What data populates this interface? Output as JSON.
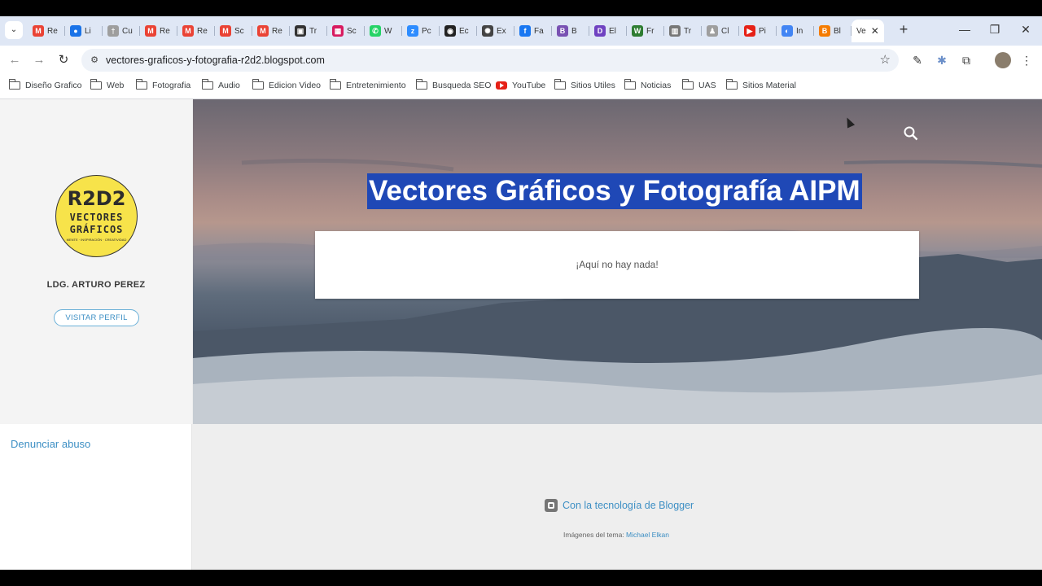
{
  "browser": {
    "tabs": [
      {
        "label": "Re",
        "icon": "gmail-icon",
        "color": "#ea4335",
        "glyph": "M"
      },
      {
        "label": "Li",
        "icon": "link-icon",
        "color": "#1a73e8",
        "glyph": "●"
      },
      {
        "label": "Cu",
        "icon": "site-icon",
        "color": "#9e9e9e",
        "glyph": "†"
      },
      {
        "label": "Re",
        "icon": "gmail-icon",
        "color": "#ea4335",
        "glyph": "M"
      },
      {
        "label": "Re",
        "icon": "gmail-icon",
        "color": "#ea4335",
        "glyph": "M"
      },
      {
        "label": "Sc",
        "icon": "gmail-icon",
        "color": "#ea4335",
        "glyph": "M"
      },
      {
        "label": "Re",
        "icon": "gmail-icon",
        "color": "#ea4335",
        "glyph": "M"
      },
      {
        "label": "Tr",
        "icon": "contact-icon",
        "color": "#333333",
        "glyph": "▣"
      },
      {
        "label": "Sc",
        "icon": "grid-icon",
        "color": "#d81b60",
        "glyph": "▦"
      },
      {
        "label": "W",
        "icon": "whatsapp-icon",
        "color": "#25d366",
        "glyph": "✆"
      },
      {
        "label": "Pc",
        "icon": "zoom-icon",
        "color": "#2d8cff",
        "glyph": "z"
      },
      {
        "label": "Ec",
        "icon": "circle-icon",
        "color": "#222222",
        "glyph": "◉"
      },
      {
        "label": "Ex",
        "icon": "openai-icon",
        "color": "#444444",
        "glyph": "✺"
      },
      {
        "label": "Fa",
        "icon": "facebook-icon",
        "color": "#1877f2",
        "glyph": "f"
      },
      {
        "label": "B",
        "icon": "bootstrap-icon",
        "color": "#7952b3",
        "glyph": "B"
      },
      {
        "label": "El",
        "icon": "purple-icon",
        "color": "#6f42c1",
        "glyph": "D"
      },
      {
        "label": "Fr",
        "icon": "w-icon",
        "color": "#2e7d32",
        "glyph": "W"
      },
      {
        "label": "Tr",
        "icon": "chart-icon",
        "color": "#777777",
        "glyph": "▥"
      },
      {
        "label": "Cl",
        "icon": "site-icon",
        "color": "#9e9e9e",
        "glyph": "♟"
      },
      {
        "label": "Pi",
        "icon": "youtube-icon",
        "color": "#e62117",
        "glyph": "▶"
      },
      {
        "label": "In",
        "icon": "chrome-icon",
        "color": "#4285f4",
        "glyph": "◐"
      },
      {
        "label": "Bl",
        "icon": "blogger-icon",
        "color": "#f57c00",
        "glyph": "B"
      }
    ],
    "active_tab": {
      "label": "Ve"
    },
    "url": "vectores-graficos-y-fotografia-r2d2.blogspot.com",
    "bookmarks": [
      {
        "label": "Diseño Grafico",
        "type": "folder"
      },
      {
        "label": "Web",
        "type": "folder"
      },
      {
        "label": "Fotografia",
        "type": "folder"
      },
      {
        "label": "Audio",
        "type": "folder"
      },
      {
        "label": "Edicion Video",
        "type": "folder"
      },
      {
        "label": "Entretenimiento",
        "type": "folder"
      },
      {
        "label": "Busqueda SEO",
        "type": "folder"
      },
      {
        "label": "YouTube",
        "type": "youtube"
      },
      {
        "label": "Sitios Utiles",
        "type": "folder"
      },
      {
        "label": "Noticias",
        "type": "folder"
      },
      {
        "label": "UAS",
        "type": "folder"
      },
      {
        "label": "Sitios Material",
        "type": "folder"
      }
    ]
  },
  "sidebar": {
    "logo": {
      "line1": "R2D2",
      "line2a": "VECTORES",
      "line2b": "GRÁFICOS",
      "tagline": "MENTE · INSPIRACIÓN · CREATIVIDAD"
    },
    "profile_name": "LDG. ARTURO PEREZ",
    "visit_profile": "VISITAR PERFIL",
    "report_abuse": "Denunciar abuso"
  },
  "blog": {
    "title": "Vectores Gráficos y Fotografía AIPM",
    "empty_message": "¡Aquí no hay nada!",
    "powered_by": "Con la tecnología de Blogger",
    "theme_credit_prefix": "Imágenes del tema: ",
    "theme_credit_author": "Michael Elkan"
  }
}
